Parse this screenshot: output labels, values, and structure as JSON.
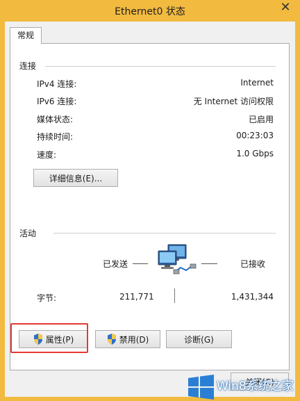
{
  "window": {
    "title": "Ethernet0 状态",
    "close_glyph": "✕"
  },
  "tabs": [
    {
      "label": "常规"
    }
  ],
  "connection": {
    "heading": "连接",
    "rows": [
      {
        "label": "IPv4 连接:",
        "value": "Internet"
      },
      {
        "label": "IPv6 连接:",
        "value": "无 Internet 访问权限"
      },
      {
        "label": "媒体状态:",
        "value": "已启用"
      },
      {
        "label": "持续时间:",
        "value": "00:23:03"
      },
      {
        "label": "速度:",
        "value": "1.0 Gbps"
      }
    ],
    "details_button": "详细信息(E)..."
  },
  "activity": {
    "heading": "活动",
    "sent_label": "已发送",
    "received_label": "已接收",
    "bytes_label": "字节:",
    "bytes_sent": "211,771",
    "bytes_received": "1,431,344",
    "icon": "network-computers-icon"
  },
  "buttons": {
    "properties": "属性(P)",
    "disable": "禁用(D)",
    "diagnose": "诊断(G)",
    "close": "关闭(C)"
  },
  "watermark": {
    "text": "Win8系统之家",
    "icon": "windows-logo-icon"
  },
  "colors": {
    "window_frame": "#f2ba3f",
    "highlight": "#e53935",
    "watermark_blue": "#2a6fb8"
  }
}
